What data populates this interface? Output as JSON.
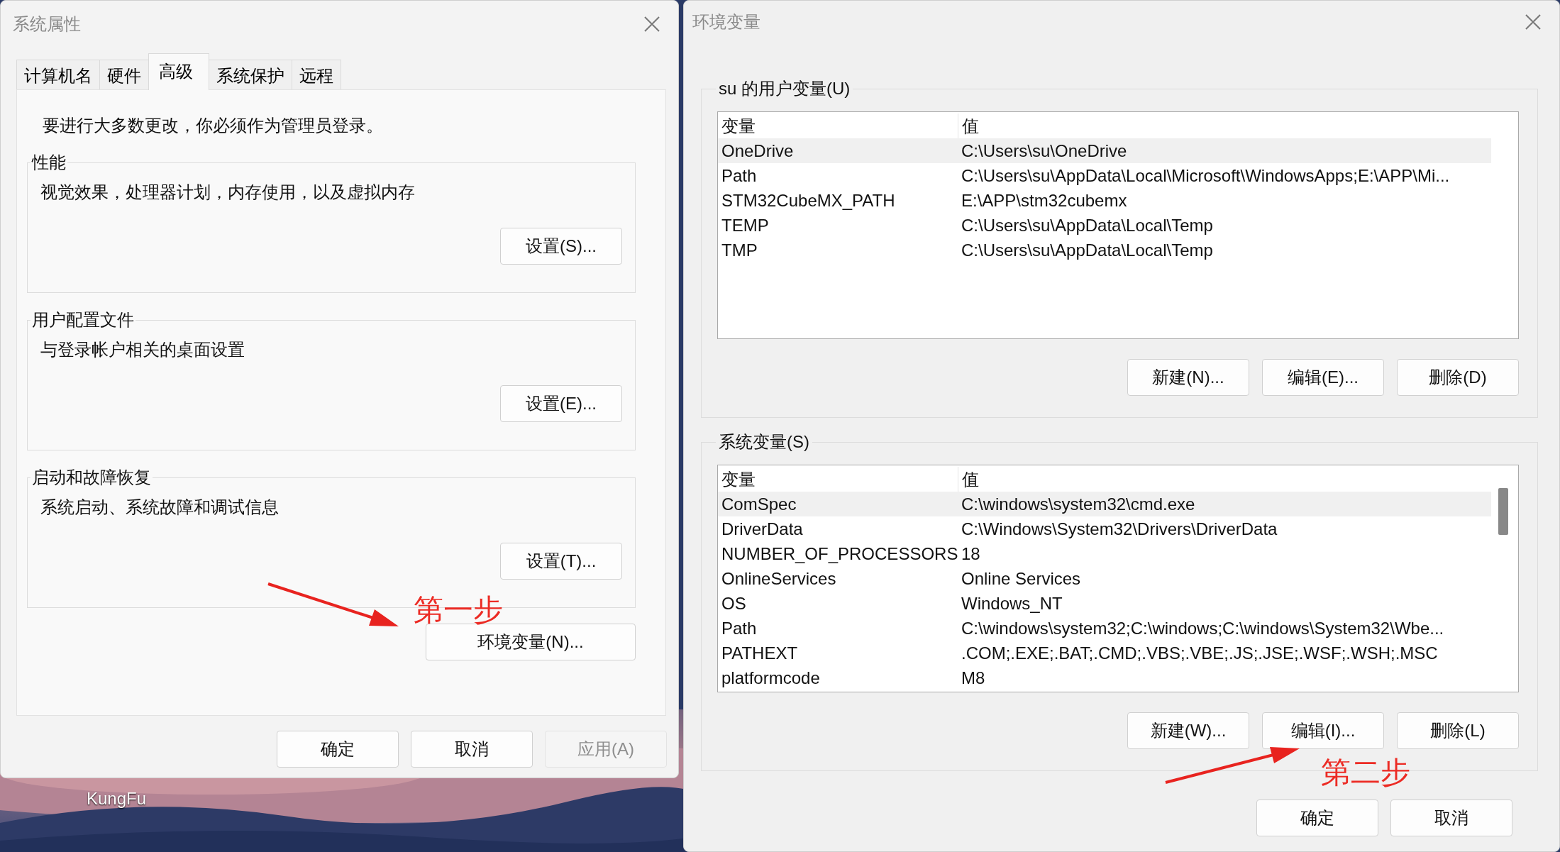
{
  "desktop": {
    "kind": "picture",
    "icon_labels": [
      "KungFu"
    ]
  },
  "system_properties": {
    "title": "系统属性",
    "tabs": [
      {
        "label": "计算机名",
        "selected": false
      },
      {
        "label": "硬件",
        "selected": false
      },
      {
        "label": "高级",
        "selected": true
      },
      {
        "label": "系统保护",
        "selected": false
      },
      {
        "label": "远程",
        "selected": false
      }
    ],
    "notice": "要进行大多数更改，你必须作为管理员登录。",
    "groups": [
      {
        "title": "性能",
        "description": "视觉效果，处理器计划，内存使用，以及虚拟内存",
        "button": "设置(S)..."
      },
      {
        "title": "用户配置文件",
        "description": "与登录帐户相关的桌面设置",
        "button": "设置(E)..."
      },
      {
        "title": "启动和故障恢复",
        "description": "系统启动、系统故障和调试信息",
        "button": "设置(T)..."
      }
    ],
    "step_label": "第一步",
    "env_button": "环境变量(N)...",
    "buttons": [
      {
        "label": "确定",
        "disabled": false
      },
      {
        "label": "取消",
        "disabled": false
      },
      {
        "label": "应用(A)",
        "disabled": true
      }
    ]
  },
  "environment_variables": {
    "title": "环境变量",
    "user_vars": {
      "title": "su 的用户变量(U)",
      "columns": [
        "变量",
        "值"
      ],
      "rows": [
        {
          "name": "OneDrive",
          "value": "C:\\Users\\su\\OneDrive",
          "selected": true
        },
        {
          "name": "Path",
          "value": "C:\\Users\\su\\AppData\\Local\\Microsoft\\WindowsApps;E:\\APP\\Mi...",
          "selected": false
        },
        {
          "name": "STM32CubeMX_PATH",
          "value": "E:\\APP\\stm32cubemx",
          "selected": false
        },
        {
          "name": "TEMP",
          "value": "C:\\Users\\su\\AppData\\Local\\Temp",
          "selected": false
        },
        {
          "name": "TMP",
          "value": "C:\\Users\\su\\AppData\\Local\\Temp",
          "selected": false
        }
      ],
      "buttons": [
        "新建(N)...",
        "编辑(E)...",
        "删除(D)"
      ]
    },
    "system_vars": {
      "title": "系统变量(S)",
      "columns": [
        "变量",
        "值"
      ],
      "rows": [
        {
          "name": "ComSpec",
          "value": "C:\\windows\\system32\\cmd.exe",
          "selected": true
        },
        {
          "name": "DriverData",
          "value": "C:\\Windows\\System32\\Drivers\\DriverData",
          "selected": false
        },
        {
          "name": "NUMBER_OF_PROCESSORS",
          "value": "18",
          "selected": false
        },
        {
          "name": "OnlineServices",
          "value": "Online Services",
          "selected": false
        },
        {
          "name": "OS",
          "value": "Windows_NT",
          "selected": false
        },
        {
          "name": "Path",
          "value": "C:\\windows\\system32;C:\\windows;C:\\windows\\System32\\Wbe...",
          "selected": false
        },
        {
          "name": "PATHEXT",
          "value": ".COM;.EXE;.BAT;.CMD;.VBS;.VBE;.JS;.JSE;.WSF;.WSH;.MSC",
          "selected": false
        },
        {
          "name": "platformcode",
          "value": "M8",
          "selected": false
        }
      ],
      "buttons": [
        "新建(W)...",
        "编辑(I)...",
        "删除(L)"
      ]
    },
    "step_label": "第二步",
    "buttons": [
      "确定",
      "取消"
    ]
  }
}
